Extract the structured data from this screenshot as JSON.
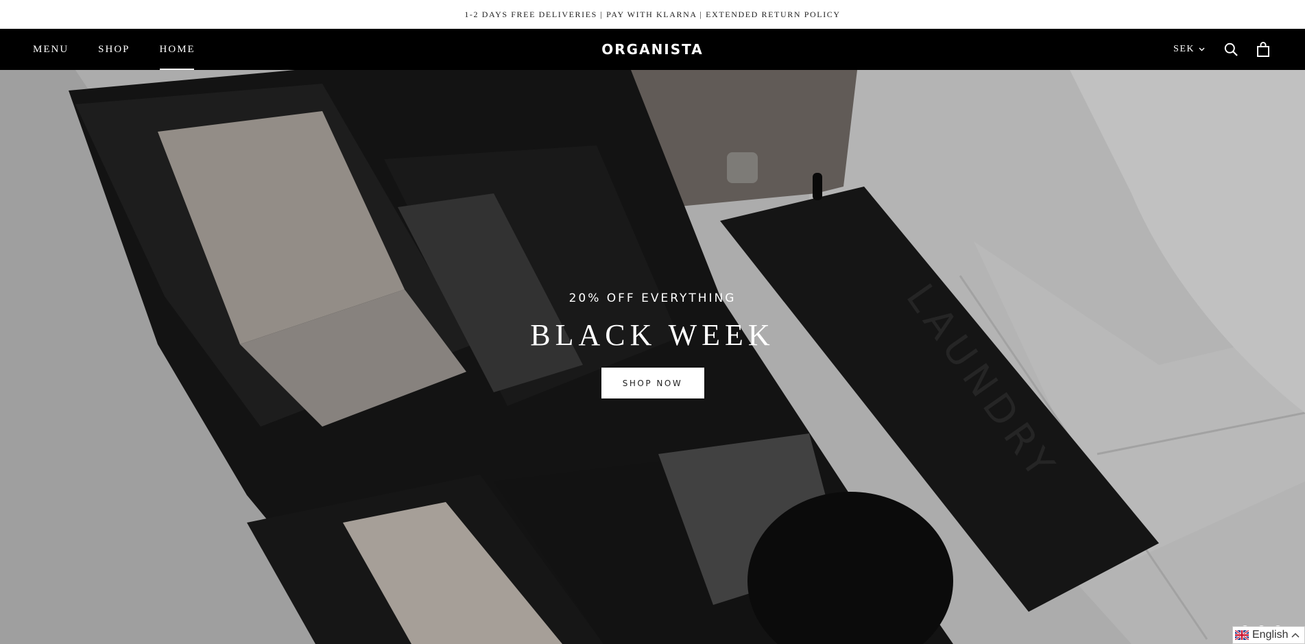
{
  "announcement": "1-2 DAYS FREE DELIVERIES | PAY WITH KLARNA | EXTENDED RETURN POLICY",
  "header": {
    "nav": [
      {
        "label": "MENU",
        "active": false
      },
      {
        "label": "SHOP",
        "active": false
      },
      {
        "label": "HOME",
        "active": true
      }
    ],
    "logo": "ORGANISTA",
    "currency": "SEK",
    "icons": [
      "chevron-down-icon",
      "search-icon",
      "shopping-bag-icon"
    ]
  },
  "hero": {
    "subtitle": "20% OFF EVERYTHING",
    "title": "BLACK WEEK",
    "button": "SHOP NOW",
    "image_text": "LAUNDRY",
    "slides": 3,
    "active_slide": 1
  },
  "language": {
    "label": "English",
    "icons": [
      "uk-flag-icon",
      "chevron-up-icon"
    ]
  },
  "colors": {
    "header_bg": "#000000",
    "header_text": "#ffffff",
    "announcement_bg": "#ffffff",
    "button_bg": "#ffffff"
  }
}
